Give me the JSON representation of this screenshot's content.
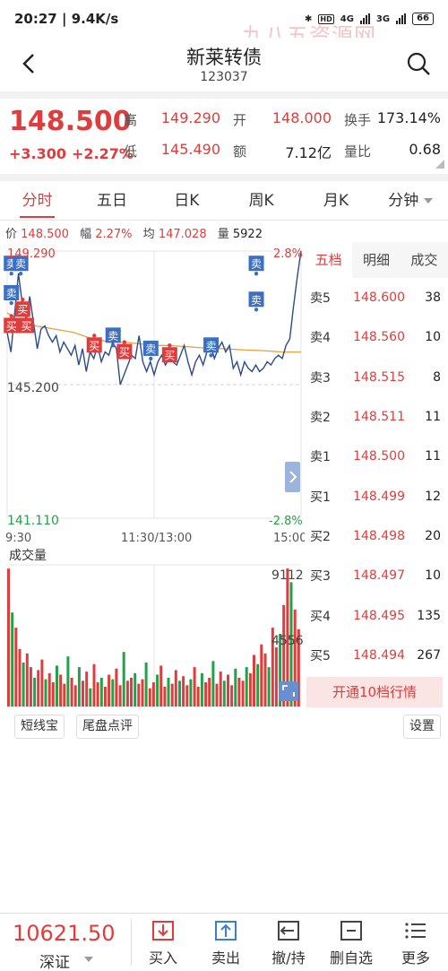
{
  "status": {
    "time": "20:27",
    "speed": "9.4K/s",
    "battery": "66",
    "net1": "4G",
    "net2": "3G",
    "hd": "HD"
  },
  "watermark": "九八五资源网",
  "header": {
    "title": "新莱转债",
    "code": "123037"
  },
  "quote": {
    "price": "148.500",
    "change": "+3.300",
    "change_pct": "+2.27%",
    "high_label": "高",
    "high": "149.290",
    "open_label": "开",
    "open": "148.000",
    "turnover_label": "换手",
    "turnover": "173.14%",
    "low_label": "低",
    "low": "145.490",
    "amount_label": "额",
    "amount": "7.12亿",
    "volratio_label": "量比",
    "volratio": "0.68"
  },
  "tabs": [
    "分时",
    "五日",
    "日K",
    "周K",
    "月K",
    "分钟"
  ],
  "info": {
    "price_label": "价",
    "price": "148.500",
    "amp_label": "幅",
    "amp": "2.27%",
    "avg_label": "均",
    "avg": "147.028",
    "vol_label": "量",
    "vol": "5922"
  },
  "chart_data": {
    "type": "line",
    "price_axis": {
      "top": "149.290",
      "mid": "145.200",
      "bottom": "141.110"
    },
    "pct_axis": {
      "top": "2.8%",
      "bottom": "-2.8%"
    },
    "time_labels": [
      "9:30",
      "11:30/13:00",
      "15:00"
    ],
    "volume_label": "成交量",
    "volume_axis": {
      "top": "9112",
      "mid": "4556"
    },
    "ylim": [
      141.11,
      149.29
    ],
    "price_series": [
      146.8,
      146.2,
      147.4,
      148.6,
      147.7,
      147.2,
      147.9,
      147.1,
      146.3,
      146.9,
      147.0,
      146.7,
      146.5,
      146.7,
      146.2,
      146.5,
      146.3,
      146.1,
      146.4,
      145.8,
      146.3,
      145.6,
      146.2,
      146.0,
      146.4,
      145.9,
      146.2,
      146.1,
      146.5,
      146.3,
      145.2,
      145.5,
      145.8,
      146.1,
      146.0,
      146.7,
      145.9,
      145.6,
      145.9,
      145.5,
      145.9,
      146.1,
      145.8,
      146.0,
      145.9,
      145.8,
      146.1,
      146.4,
      145.9,
      145.5,
      145.9,
      146.1,
      145.8,
      146.2,
      146.4,
      146.0,
      146.3,
      146.5,
      146.2,
      146.4,
      145.7,
      145.9,
      145.5,
      145.9,
      145.7,
      145.6,
      145.8,
      145.6,
      145.7,
      145.9,
      145.8,
      146.0,
      146.1,
      146.0,
      146.4,
      146.6,
      147.6,
      148.5,
      149.3
    ],
    "avg_series": [
      147.4,
      147.2,
      147.1,
      147.0,
      146.95,
      146.9,
      146.85,
      146.8,
      146.7,
      146.6,
      146.55,
      146.5,
      146.5,
      146.48,
      146.45,
      146.42,
      146.4,
      146.4,
      146.38,
      146.36,
      146.34,
      146.32,
      146.3,
      146.3,
      146.28,
      146.26,
      146.25,
      146.24,
      146.22,
      146.2,
      146.2,
      146.2
    ],
    "signals": [
      {
        "i": 1,
        "price": 148.9,
        "type": "卖"
      },
      {
        "i": 3,
        "price": 148.9,
        "type": "卖"
      },
      {
        "i": 1,
        "price": 148.0,
        "type": "卖"
      },
      {
        "i": 1,
        "price": 147.0,
        "type": "买"
      },
      {
        "i": 4,
        "price": 147.5,
        "type": "买"
      },
      {
        "i": 5,
        "price": 147.0,
        "type": "买"
      },
      {
        "i": 23,
        "price": 146.4,
        "type": "买"
      },
      {
        "i": 28,
        "price": 146.7,
        "type": "卖"
      },
      {
        "i": 31,
        "price": 146.2,
        "type": "买"
      },
      {
        "i": 38,
        "price": 146.3,
        "type": "卖"
      },
      {
        "i": 43,
        "price": 146.1,
        "type": "买"
      },
      {
        "i": 54,
        "price": 146.4,
        "type": "卖"
      },
      {
        "i": 66,
        "price": 148.9,
        "type": "卖"
      },
      {
        "i": 66,
        "price": 147.8,
        "type": "卖"
      }
    ],
    "volume_series": [
      9100,
      6200,
      5200,
      3800,
      2900,
      3500,
      2600,
      1900,
      2400,
      3100,
      1800,
      2200,
      1600,
      2700,
      2100,
      1500,
      3300,
      1900,
      1400,
      2600,
      1700,
      2300,
      1200,
      2800,
      1600,
      1900,
      1300,
      2100,
      1800,
      2500,
      1400,
      3600,
      1700,
      1900,
      2200,
      1500,
      1800,
      2900,
      1200,
      1600,
      2100,
      2700,
      1300,
      1900,
      1500,
      2400,
      1700,
      2000,
      1400,
      1800,
      2600,
      1300,
      2200,
      1600,
      1900,
      3000,
      1500,
      2300,
      1700,
      2100,
      1400,
      2500,
      1900,
      1700,
      2600,
      2200,
      3400,
      2800,
      4100,
      3500,
      2600,
      5200,
      3900,
      4800,
      6700,
      9112,
      8200,
      6400,
      5100
    ]
  },
  "orderbook": {
    "tabs": [
      "五档",
      "明细",
      "成交"
    ],
    "rows": [
      {
        "label": "卖5",
        "price": "148.600",
        "vol": "38"
      },
      {
        "label": "卖4",
        "price": "148.560",
        "vol": "10"
      },
      {
        "label": "卖3",
        "price": "148.515",
        "vol": "8"
      },
      {
        "label": "卖2",
        "price": "148.511",
        "vol": "11"
      },
      {
        "label": "卖1",
        "price": "148.500",
        "vol": "11"
      },
      {
        "label": "买1",
        "price": "148.499",
        "vol": "12"
      },
      {
        "label": "买2",
        "price": "148.498",
        "vol": "20"
      },
      {
        "label": "买3",
        "price": "148.497",
        "vol": "10"
      },
      {
        "label": "买4",
        "price": "148.495",
        "vol": "135"
      },
      {
        "label": "买5",
        "price": "148.494",
        "vol": "267"
      }
    ],
    "upgrade": "开通10档行情"
  },
  "tools": {
    "short": "短线宝",
    "tail": "尾盘点评",
    "settings": "设置"
  },
  "bottom": {
    "index_value": "10621.50",
    "index_name": "深证",
    "buy": "买入",
    "sell": "卖出",
    "cancel": "撤/持",
    "remove": "删自选",
    "more": "更多"
  },
  "colors": {
    "up": "#e03c3c",
    "down": "#21a24a",
    "price_line": "#2a4a8a",
    "avg_line": "#e6a23c",
    "sell_tag": "#3a6fc4",
    "buy_tag": "#e03c3c"
  }
}
